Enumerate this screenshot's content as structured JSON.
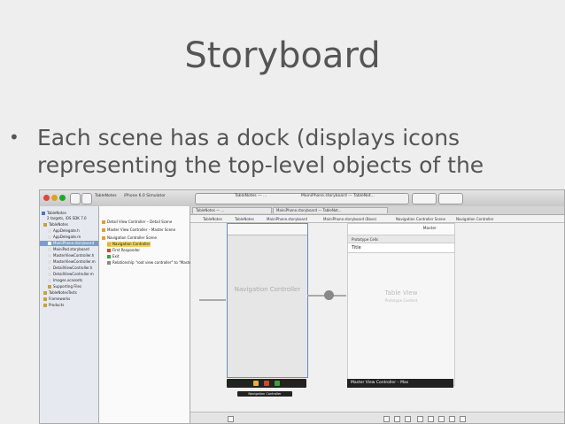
{
  "slide": {
    "title": "Storyboard",
    "bullet_marker": "•",
    "bullet_text": "Each scene has a dock (displays icons representing the top-level objects of the"
  },
  "xcode": {
    "toolbar": {
      "scheme": "TableNotes",
      "destination": "iPhone 6.0 Simulator",
      "tab1": "TableNotes — ...",
      "tab2": "MainiPhone.storyboard — TableNot..."
    },
    "breadcrumb": [
      "TableNotes",
      "TableNotes",
      "MainiPhone.storyboard",
      "MainiPhone.storyboard (Base)",
      "Navigation Controller Scene",
      "Navigation Controller"
    ],
    "navigator_items": [
      "TableNotes",
      "2 targets, iOS SDK 7.0",
      "TableNotes",
      "AppDelegate.h",
      "AppDelegate.m",
      "MainiPhone.storyboard",
      "MainiPad.storyboard",
      "MasterViewController.h",
      "MasterViewController.m",
      "DetailViewController.h",
      "DetailViewController.m",
      "Images.xcassets",
      "Supporting Files",
      "TableNotesTests",
      "Frameworks",
      "Products"
    ],
    "outline_items": [
      "Detail View Controller – Detail Scene",
      "Master View Controller – Master Scene",
      "Navigation Controller Scene",
      "Navigation Controller",
      "First Responder",
      "Exit",
      "Relationship \"root view controller\" to \"Maste..."
    ],
    "nav_scene_label": "Navigation Controller",
    "dock_tooltip": "Navigation Controller",
    "master": {
      "nav_title": "Master",
      "section_label": "Prototype Cells",
      "cell_title": "Title",
      "table_label": "Table View",
      "table_sub": "Prototype Content",
      "dock_label": "Master View Controller – Mas"
    },
    "colors": {
      "selection": "#7d9ccc",
      "dock": "#222222",
      "dock_yellow": "#e6b23a",
      "dock_red": "#d04a2a",
      "dock_green": "#3aa040"
    }
  }
}
